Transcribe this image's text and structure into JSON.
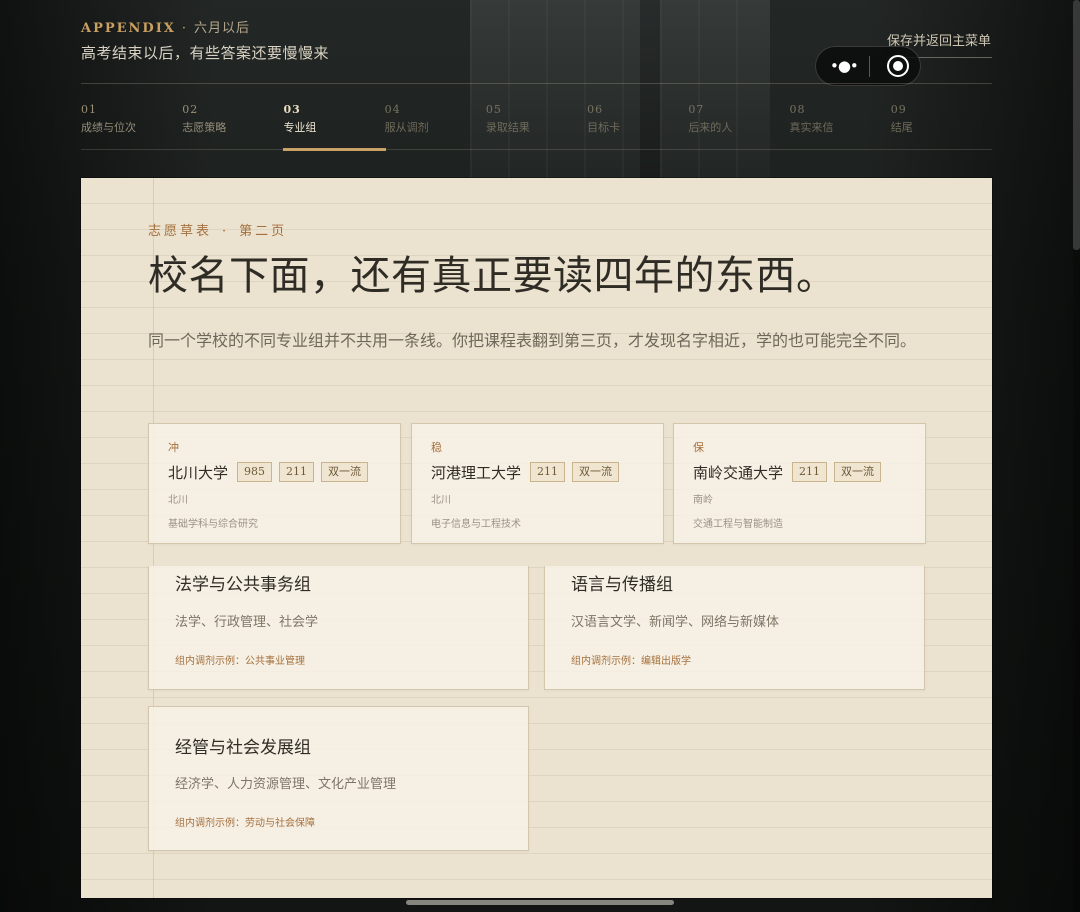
{
  "header": {
    "kicker": "APPENDIX",
    "kicker_dot": "·",
    "kicker_sub": "六月以后",
    "title": "高考结束以后，有些答案还要慢慢来",
    "save_link": "保存并返回主菜单"
  },
  "capsule": {
    "more_glyph": "•●•"
  },
  "steps": [
    {
      "num": "01",
      "label": "成绩与位次"
    },
    {
      "num": "02",
      "label": "志愿策略"
    },
    {
      "num": "03",
      "label": "专业组"
    },
    {
      "num": "04",
      "label": "服从调剂"
    },
    {
      "num": "05",
      "label": "录取结果"
    },
    {
      "num": "06",
      "label": "目标卡"
    },
    {
      "num": "07",
      "label": "后来的人"
    },
    {
      "num": "08",
      "label": "真实来信"
    },
    {
      "num": "09",
      "label": "结尾"
    }
  ],
  "active_step": 2,
  "paper": {
    "eyebrow_a": "志愿草表",
    "eyebrow_sep": "·",
    "eyebrow_b": "第二页",
    "hero": "校名下面，还有真正要读四年的东西。",
    "lede": "同一个学校的不同专业组并不共用一条线。你把课程表翻到第三页，才发现名字相近，学的也可能完全不同。"
  },
  "schools": [
    {
      "tier": "冲",
      "name": "北川大学",
      "tags": [
        "985",
        "211",
        "双一流"
      ],
      "city": "北川",
      "focus": "基础学科与综合研究"
    },
    {
      "tier": "稳",
      "name": "河港理工大学",
      "tags": [
        "211",
        "双一流"
      ],
      "city": "北川",
      "focus": "电子信息与工程技术"
    },
    {
      "tier": "保",
      "name": "南岭交通大学",
      "tags": [
        "211",
        "双一流"
      ],
      "city": "南岭",
      "focus": "交通工程与智能制造"
    }
  ],
  "groups": [
    {
      "name": "法学与公共事务组",
      "majors": "法学、行政管理、社会学",
      "example": "组内调剂示例：公共事业管理"
    },
    {
      "name": "语言与传播组",
      "majors": "汉语言文学、新闻学、网络与新媒体",
      "example": "组内调剂示例：编辑出版学"
    },
    {
      "name": "经管与社会发展组",
      "majors": "经济学、人力资源管理、文化产业管理",
      "example": "组内调剂示例：劳动与社会保障"
    }
  ],
  "colors": {
    "accent": "#c9a061",
    "paper": "#ebe2cf",
    "ink": "#2f2c26",
    "tier": "#a4703d"
  }
}
